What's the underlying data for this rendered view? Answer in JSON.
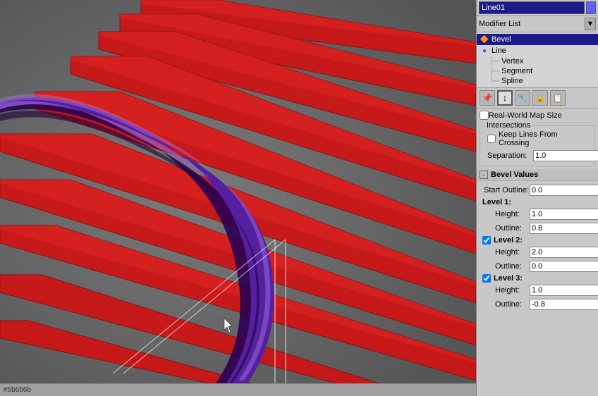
{
  "viewport": {
    "background": "#6b6b6b"
  },
  "panel": {
    "object_name": "Line01",
    "color_swatch": "#6060ff",
    "modifier_list_label": "Modifier List",
    "modifier_tree": [
      {
        "id": "bevel",
        "label": "Bevel",
        "indent": 0,
        "selected": true,
        "icon": "🔶"
      },
      {
        "id": "line",
        "label": "Line",
        "indent": 0,
        "selected": false,
        "icon": "📄"
      },
      {
        "id": "vertex",
        "label": "Vertex",
        "indent": 1,
        "selected": false,
        "icon": ""
      },
      {
        "id": "segment",
        "label": "Segment",
        "indent": 1,
        "selected": false,
        "icon": ""
      },
      {
        "id": "spline",
        "label": "Spline",
        "indent": 1,
        "selected": false,
        "icon": ""
      }
    ],
    "toolbar": {
      "buttons": [
        "⊕",
        "↕",
        "🔧",
        "🔒",
        "📋"
      ]
    },
    "real_world_map_size": {
      "label": "Real-World Map Size",
      "checked": false
    },
    "intersections": {
      "group_label": "Intersections",
      "keep_lines_label": "Keep Lines From Crossing",
      "keep_lines_checked": false,
      "separation_label": "Separation:",
      "separation_value": "1.0"
    },
    "bevel_values": {
      "section_label": "Bevel Values",
      "start_outline_label": "Start Outline:",
      "start_outline_value": "0.0",
      "level1": {
        "label": "Level 1:",
        "height_label": "Height:",
        "height_value": "1.0",
        "outline_label": "Outline:",
        "outline_value": "0.8",
        "checked": false
      },
      "level2": {
        "label": "Level 2:",
        "height_label": "Height:",
        "height_value": "2.0",
        "outline_label": "Outline:",
        "outline_value": "0.0",
        "checked": true
      },
      "level3": {
        "label": "Level 3:",
        "height_label": "Height:",
        "height_value": "1.0",
        "outline_label": "Outline:",
        "outline_value": "-0.8",
        "checked": true
      }
    }
  }
}
